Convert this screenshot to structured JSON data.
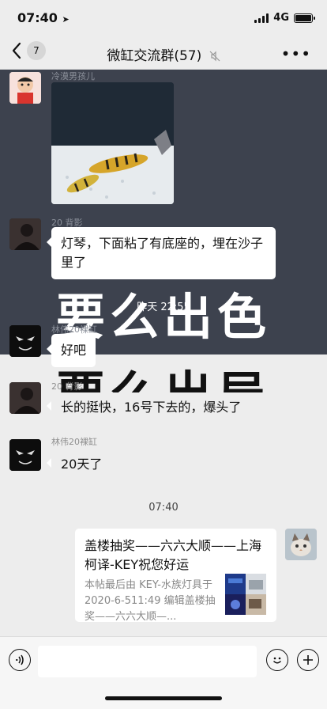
{
  "status": {
    "time": "07:40",
    "network": "4G"
  },
  "header": {
    "back_count": "7",
    "title": "微缸交流群(57)"
  },
  "messages": {
    "m1": {
      "nick": "冷漠男孩儿"
    },
    "m2": {
      "nick": "20 背影",
      "text": "灯琴，下面粘了有底座的，埋在沙子里了"
    },
    "ts1": "昨天 22:55",
    "overlay": {
      "line1": "要么出色",
      "line2": "要么出局"
    },
    "m3": {
      "nick": "林伟20裸缸",
      "text": "好吧"
    },
    "m4": {
      "nick": "20 背影",
      "text": "长的挺快，16号下去的，爆头了"
    },
    "m5": {
      "nick": "林伟20裸缸",
      "text": "20天了"
    },
    "ts2": "07:40",
    "share": {
      "title": "盖楼抽奖——六六大顺——上海柯译-KEY祝您好运",
      "desc": "本帖最后由 KEY-水族灯具于 2020-6-511:49 编辑盖楼抽奖——六六大顺—..."
    }
  },
  "colors": {
    "overlay_bg": "#3d424e",
    "bubble": "#ffffff",
    "chat_bg": "#ededed"
  },
  "icons": [
    "location-arrow-icon",
    "signal-icon",
    "battery-icon",
    "back-chevron-icon",
    "mute-icon",
    "more-icon",
    "voice-icon",
    "emoji-icon",
    "plus-icon"
  ]
}
